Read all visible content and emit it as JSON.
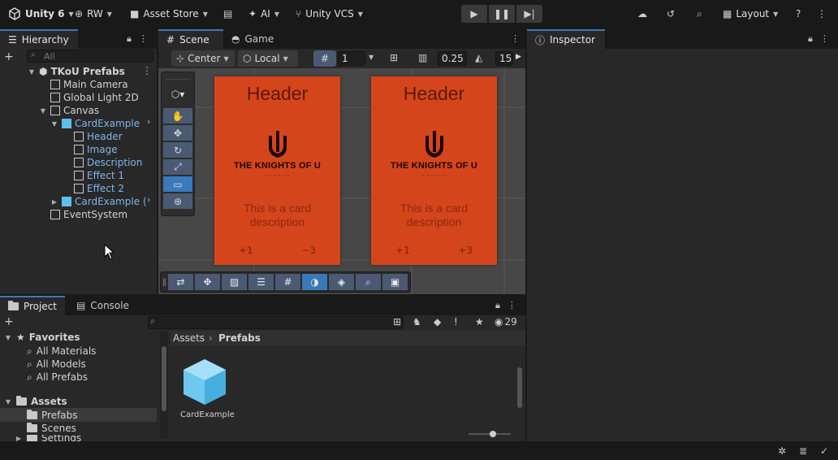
{
  "toolbar": {
    "account": "Unity 6",
    "user": "RW",
    "asset_store": "Asset Store",
    "ai": "AI",
    "vcs": "Unity VCS",
    "layout": "Layout"
  },
  "hierarchy": {
    "tab_label": "Hierarchy",
    "search_placeholder": "All",
    "scene_name": "TKoU Prefabs",
    "items": [
      {
        "label": "Main Camera"
      },
      {
        "label": "Global Light 2D"
      },
      {
        "label": "Canvas"
      },
      {
        "label": "CardExample"
      },
      {
        "label": "Header"
      },
      {
        "label": "Image"
      },
      {
        "label": "Description"
      },
      {
        "label": "Effect 1"
      },
      {
        "label": "Effect 2"
      },
      {
        "label": "CardExample ("
      },
      {
        "label": "EventSystem"
      }
    ]
  },
  "scene": {
    "tab_scene": "Scene",
    "tab_game": "Game",
    "pivot": "Center",
    "space": "Local",
    "grid_value": "1",
    "snap_value": "0.25",
    "fov_value": "15",
    "cards": [
      {
        "header": "Header",
        "brand": "THE KNIGHTS OF U",
        "subtitle": "— — — — — —",
        "description": "This is a card description",
        "effect1": "+1",
        "effect2": "−3"
      },
      {
        "header": "Header",
        "brand": "THE KNIGHTS OF U",
        "subtitle": "— — — — — —",
        "description": "This is a card description",
        "effect1": "+1",
        "effect2": "+3"
      }
    ]
  },
  "inspector": {
    "tab_label": "Inspector"
  },
  "project": {
    "tab_project": "Project",
    "tab_console": "Console",
    "hidden_count": "29",
    "favorites_label": "Favorites",
    "favorites": [
      {
        "label": "All Materials"
      },
      {
        "label": "All Models"
      },
      {
        "label": "All Prefabs"
      }
    ],
    "assets_label": "Assets",
    "folders": [
      {
        "label": "Prefabs"
      },
      {
        "label": "Scenes"
      },
      {
        "label": "Settings"
      }
    ],
    "breadcrumb": [
      "Assets",
      "Prefabs"
    ],
    "asset_items": [
      {
        "label": "CardExample"
      }
    ]
  }
}
